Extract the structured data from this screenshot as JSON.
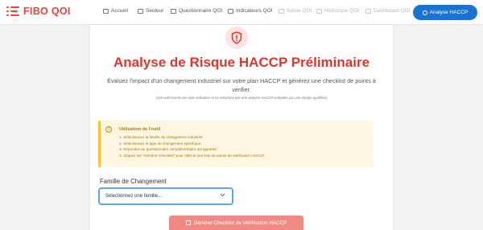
{
  "brand": {
    "name": "FIBO QOI",
    "color": "#e8423b"
  },
  "nav": {
    "items": [
      {
        "label": "Accueil",
        "icon": "home-icon"
      },
      {
        "label": "Secteur",
        "icon": "factory-icon"
      },
      {
        "label": "Questionnaire QOI",
        "icon": "clipboard-icon"
      },
      {
        "label": "Indicateurs QOI",
        "icon": "chart-icon"
      },
      {
        "label": "Saisie QOI",
        "icon": "edit-icon"
      },
      {
        "label": "Historique QOI",
        "icon": "history-icon"
      },
      {
        "label": "Dashboard QOI",
        "icon": "dashboard-icon"
      }
    ],
    "active": {
      "label": "Analyse HACCP",
      "icon": "shield-icon"
    },
    "active_color": "#1a73d1"
  },
  "main": {
    "icon": "shield-alert-icon",
    "title": "Analyse de Risque HACCP Préliminaire",
    "subtitle": "Évaluez l'impact d'un changement industriel sur votre plan HACCP et générez une checklist de points à vérifier.",
    "disclaimer": "(Cet outil fournit une aide indicative et ne remplace pas une analyse HACCP complète par une équipe qualifiée)"
  },
  "info": {
    "icon": "info-icon",
    "title": "Utilisation de l'outil",
    "steps": [
      "1. Sélectionnez la famille du changement industriel.",
      "2. Sélectionnez le type de changement spécifique.",
      "3. Répondez au questionnaire complémentaire qui apparaît.",
      "4. Cliquez sur \"Générer Checklist\" pour obtenir une liste de points de vérification HACCP."
    ]
  },
  "form": {
    "label": "Famille de Changement",
    "select_value": "Sélectionnez une famille..."
  },
  "button": {
    "label": "Générer Checklist de Vérification HACCP",
    "icon": "checklist-icon"
  }
}
